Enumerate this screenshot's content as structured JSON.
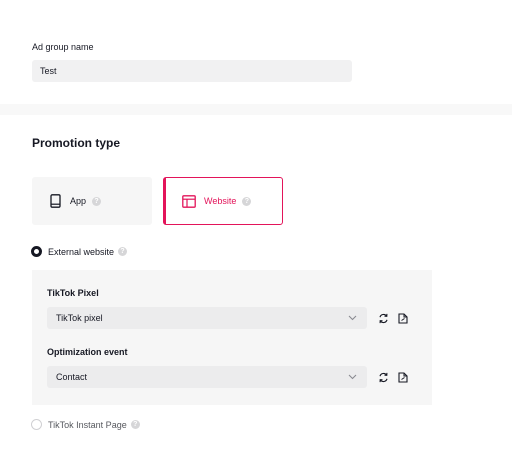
{
  "ad_group": {
    "label": "Ad group name",
    "value": "Test"
  },
  "promotion": {
    "title": "Promotion type",
    "options": [
      {
        "label": "App",
        "icon": "phone-icon",
        "selected": false
      },
      {
        "label": "Website",
        "icon": "browser-window-icon",
        "selected": true
      }
    ],
    "help_glyph": "?"
  },
  "destinations": {
    "external": {
      "label": "External website",
      "checked": true
    },
    "instant_page": {
      "label": "TikTok Instant Page",
      "checked": false
    }
  },
  "pixel": {
    "label": "TikTok Pixel",
    "value": "TikTok pixel"
  },
  "optimization": {
    "label": "Optimization event",
    "value": "Contact"
  },
  "colors": {
    "accent": "#e3145a",
    "text": "#161823",
    "muted_bg": "#f6f6f6"
  }
}
